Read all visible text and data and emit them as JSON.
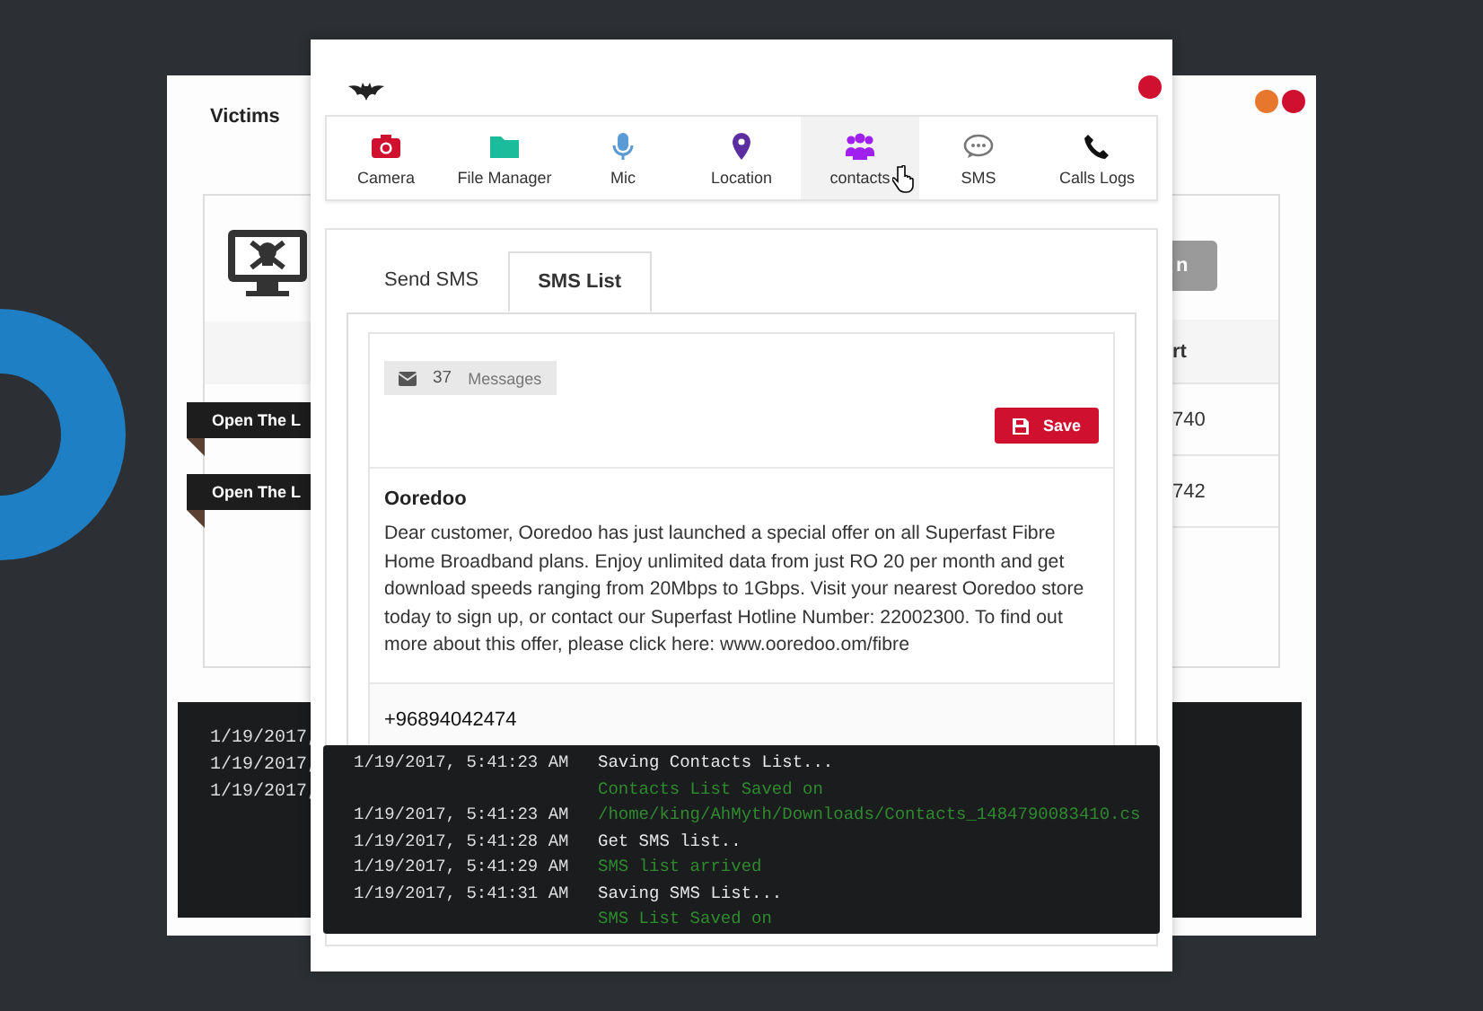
{
  "back_window": {
    "tab": "Victims",
    "window_buttons": [
      {
        "color": "#e8772e"
      },
      {
        "color": "#d0102f"
      }
    ],
    "victims_panel": {
      "button": "n",
      "column_header": "rt",
      "rows": [
        "740",
        "742"
      ],
      "ribbons": [
        "Open The L",
        "Open The L"
      ]
    },
    "console": [
      "1/19/2017,",
      "1/19/2017,",
      "1/19/2017,"
    ]
  },
  "front_window": {
    "window_buttons": [
      {
        "color": "#d0102f"
      }
    ],
    "toolbar": [
      {
        "label": "Camera",
        "selected": false
      },
      {
        "label": "File Manager",
        "selected": false
      },
      {
        "label": "Mic",
        "selected": false
      },
      {
        "label": "Location",
        "selected": false
      },
      {
        "label": "contacts",
        "selected": true
      },
      {
        "label": "SMS",
        "selected": false
      },
      {
        "label": "Calls Logs",
        "selected": false
      }
    ],
    "tabs": [
      {
        "label": "Send SMS",
        "selected": false
      },
      {
        "label": "SMS List",
        "selected": true
      }
    ],
    "sms_count": "37",
    "sms_count_label": "Messages",
    "save_button": "Save",
    "messages": [
      {
        "sender": "Ooredoo",
        "body": "Dear customer, Ooredoo has just launched a special offer on all Superfast Fibre Home Broadband plans. Enjoy unlimited data from just RO 20 per month and get download speeds ranging from 20Mbps to 1Gbps. Visit your nearest Ooredoo store today to sign up, or contact our Superfast Hotline Number: 22002300. To find out more about this offer, please click here: www.ooredoo.om/fibre"
      },
      {
        "sender": "+96894042474"
      }
    ],
    "console": [
      {
        "time": "1/19/2017, 5:41:23 AM",
        "text": "Saving Contacts List...",
        "kind": "info"
      },
      {
        "text": "Contacts List Saved on",
        "kind": "success"
      },
      {
        "time": "1/19/2017, 5:41:23 AM",
        "text": "/home/king/AhMyth/Downloads/Contacts_1484790083410.cs",
        "kind": "success"
      },
      {
        "time": "1/19/2017, 5:41:28 AM",
        "text": "Get SMS list..",
        "kind": "info"
      },
      {
        "time": "1/19/2017, 5:41:29 AM",
        "text": "SMS list arrived",
        "kind": "success"
      },
      {
        "time": "1/19/2017, 5:41:31 AM",
        "text": "Saving SMS List...",
        "kind": "info"
      },
      {
        "text": "SMS List Saved on",
        "kind": "success"
      }
    ]
  }
}
